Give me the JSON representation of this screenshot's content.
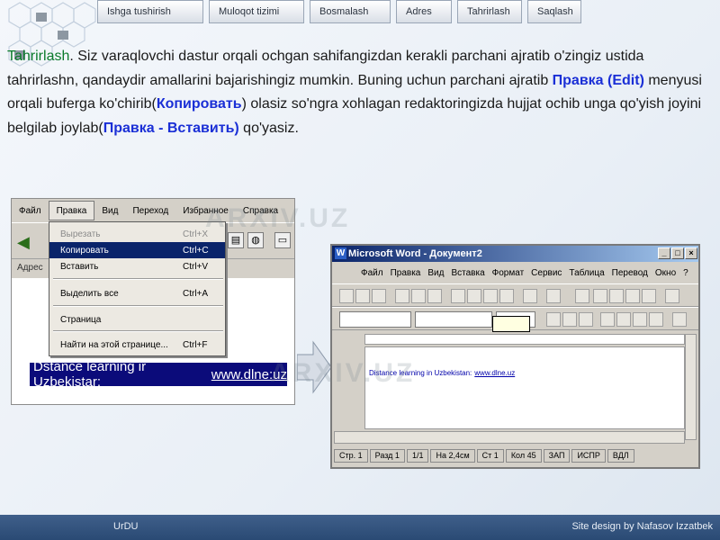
{
  "nav": [
    {
      "label": "Ishga tushirish"
    },
    {
      "label": "Muloqot tizimi"
    },
    {
      "label": "Bosmalash"
    },
    {
      "label": "Adres"
    },
    {
      "label": "Tahrirlash"
    },
    {
      "label": "Saqlash"
    }
  ],
  "paragraph": {
    "term": "Tahrirlash",
    "t1": ". Siz varaqlovchi dastur orqali ochgan sahifangizdan kerakli parchani ajratib o'zingiz ustida tahrirlashn, qandaydir amallarini bajarishingiz mumkin. Buning uchun parchani ajratib ",
    "menu_edit": "Правка (Edit)",
    "t2": " menyusi orqali buferga ko'chirib(",
    "copy": "Копировать",
    "t3": ") olasiz so'ngra xohlagan redaktoringizda hujjat ochib unga qo'yish joyini belgilab joylab(",
    "paste": "Правка - Вставить)",
    "t4": " qo'yasiz."
  },
  "browser": {
    "menu": [
      "Файл",
      "Правка",
      "Вид",
      "Переход",
      "Избранное",
      "Справка"
    ],
    "address_label": "Адрес",
    "banner_text": "Dstance learning ir Uzbekistar:",
    "banner_link": "www.dlne:uz"
  },
  "dropdown": {
    "items": [
      {
        "label": "Вырезать",
        "shortcut": "Ctrl+X",
        "state": "disabled"
      },
      {
        "label": "Копировать",
        "shortcut": "Ctrl+C",
        "state": "highlighted"
      },
      {
        "label": "Вставить",
        "shortcut": "Ctrl+V",
        "state": "normal"
      },
      {
        "label": "Выделить все",
        "shortcut": "Ctrl+A",
        "state": "normal"
      },
      {
        "label": "Страница",
        "shortcut": "",
        "state": "normal"
      },
      {
        "label": "Найти на этой странице...",
        "shortcut": "Ctrl+F",
        "state": "normal"
      }
    ]
  },
  "word": {
    "title": "Microsoft Word - Документ2",
    "menu": [
      "Файл",
      "Правка",
      "Вид",
      "Вставка",
      "Формат",
      "Сервис",
      "Таблица",
      "Перевод",
      "Окно",
      "?"
    ],
    "doc_text": "Distance learning in Uzbekistan:",
    "doc_link": "www.dlne.uz",
    "status": [
      "Стр. 1",
      "Разд 1",
      "1/1",
      "На 2,4см",
      "Ст 1",
      "Кол 45",
      "ЗАП",
      "ИСПР",
      "ВДЛ"
    ]
  },
  "watermark": "ARXIV.UZ",
  "footer": {
    "left": "UrDU",
    "right": "Site design by Nafasov Izzatbek"
  },
  "colors": {
    "accent_green": "#0a7a2a",
    "accent_blue": "#1a2fd6",
    "highlight": "#0a246a"
  }
}
